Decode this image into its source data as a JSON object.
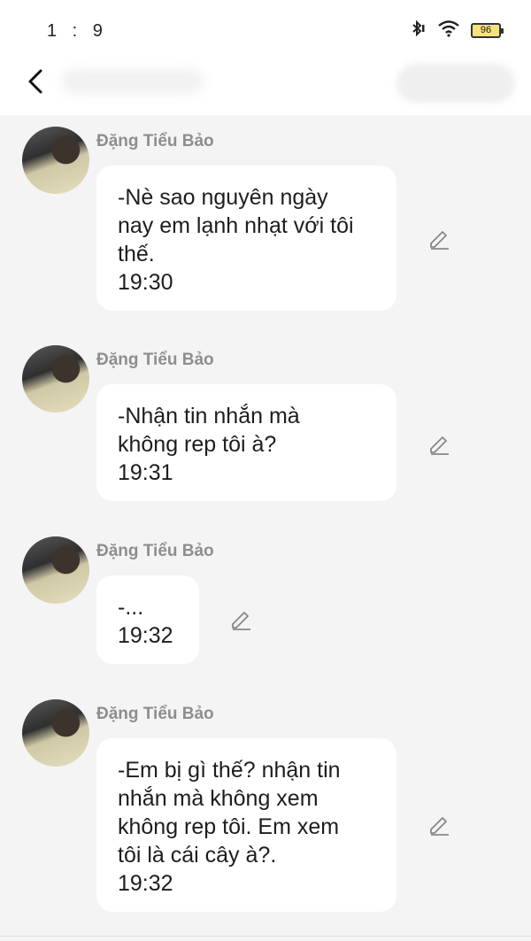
{
  "status_bar": {
    "time": "1 : 9",
    "battery": "96",
    "icons": [
      "bluetooth-icon",
      "wifi-icon",
      "battery-icon"
    ]
  },
  "nav": {
    "back_icon": "chevron-left-icon"
  },
  "messages": [
    {
      "sender": "Đặng Tiểu Bảo",
      "lines": [
        "-Nè sao nguyên ngày",
        "nay em lạnh nhạt với tôi",
        "thế."
      ],
      "time": "19:30"
    },
    {
      "sender": "Đặng Tiểu Bảo",
      "lines": [
        "-Nhận tin nhắn mà",
        "không rep tôi à?"
      ],
      "time": "19:31"
    },
    {
      "sender": "Đặng Tiểu Bảo",
      "lines": [
        "-..."
      ],
      "time": "19:32"
    },
    {
      "sender": "Đặng Tiểu Bảo",
      "lines": [
        "-Em bị gì thế? nhận tin",
        "nhắn mà không xem",
        "không rep tôi. Em xem",
        "tôi là cái cây à?."
      ],
      "time": "19:32"
    }
  ],
  "colors": {
    "background": "#f4f4f4",
    "bubble": "#ffffff",
    "sender": "#8e8e8e",
    "text": "#1d1d1d",
    "battery_fill": "#f6e27c"
  }
}
